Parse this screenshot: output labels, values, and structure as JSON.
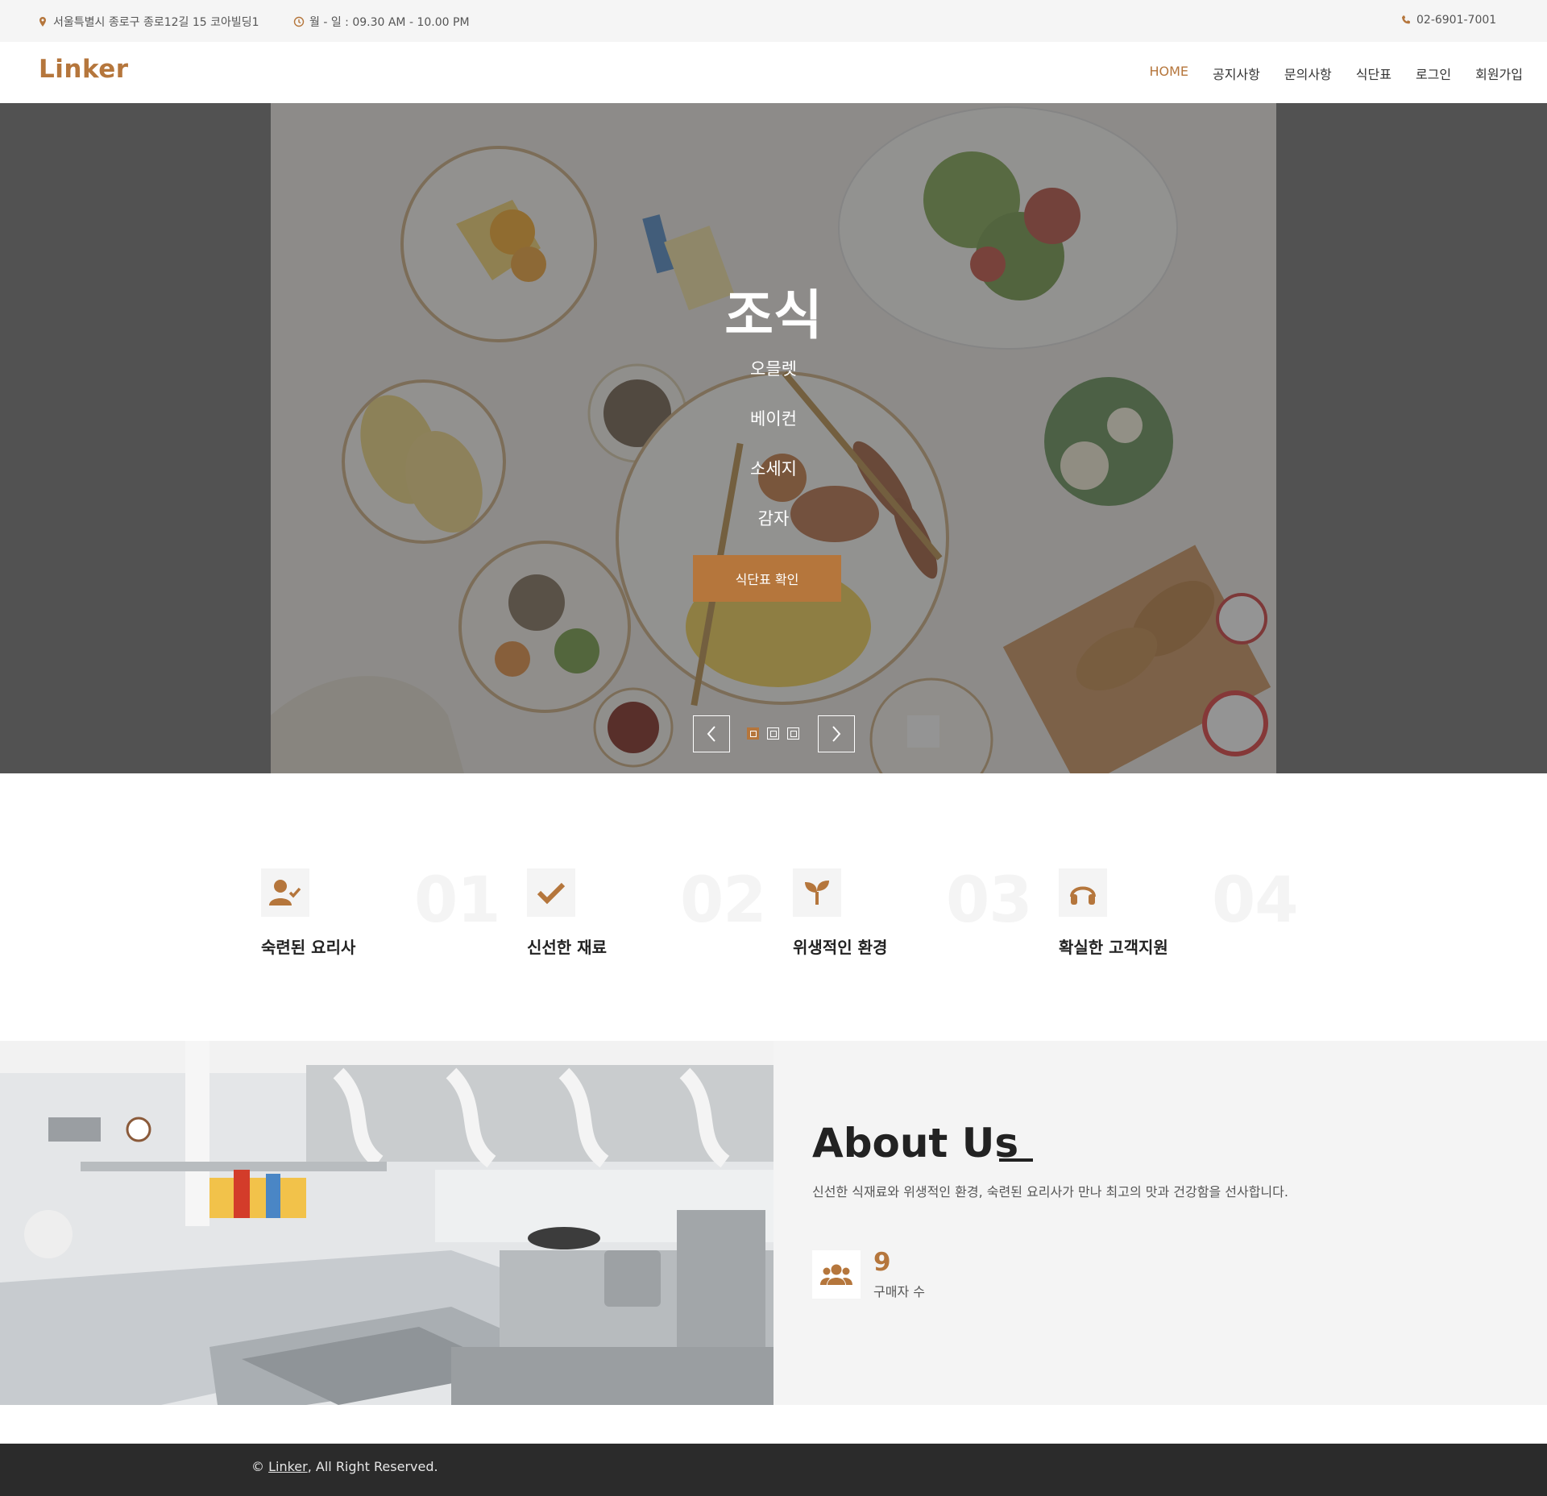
{
  "topbar": {
    "address": "서울특별시 종로구 종로12길 15 코아빌딩1",
    "hours": "월 - 일 : 09.30 AM - 10.00 PM",
    "phone": "02-6901-7001"
  },
  "header": {
    "logo": "Linker",
    "nav": [
      "HOME",
      "공지사항",
      "문의사항",
      "식단표",
      "로그인",
      "회원가입"
    ],
    "active_nav": "HOME"
  },
  "hero": {
    "title": "조식",
    "items": [
      "오믈렛",
      "베이컨",
      "소세지",
      "감자"
    ],
    "button": "식단표 확인",
    "slides": 3,
    "active_slide": 1
  },
  "features": [
    {
      "icon": "chef-check-icon",
      "number": "01",
      "title": "숙련된 요리사"
    },
    {
      "icon": "check-icon",
      "number": "02",
      "title": "신선한 재료"
    },
    {
      "icon": "sprout-icon",
      "number": "03",
      "title": "위생적인 환경"
    },
    {
      "icon": "headphones-icon",
      "number": "04",
      "title": "확실한 고객지원"
    }
  ],
  "about": {
    "title": "About Us",
    "text": "신선한 식재료와 위생적인 환경, 숙련된 요리사가 만나 최고의 맛과 건강함을 선사합니다.",
    "stat_value": "9",
    "stat_label": "구매자 수"
  },
  "footer": {
    "copyright_symbol": "©",
    "brand": "Linker",
    "rights": ", All Right Reserved."
  },
  "colors": {
    "accent": "#b5763c",
    "topbar_bg": "#f5f5f5",
    "about_bg": "#f4f4f4",
    "footer_bg": "#2b2b2b"
  }
}
